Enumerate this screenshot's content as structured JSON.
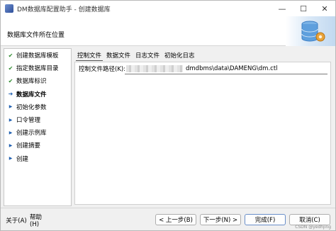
{
  "window": {
    "title": "DM数据库配置助手 - 创建数据库",
    "controls": {
      "minimize": "—",
      "maximize": "☐",
      "close": "✕"
    }
  },
  "header": {
    "title": "数据库文件所在位置",
    "art_icon": "database-gear-icon"
  },
  "steps": [
    {
      "label": "创建数据库模板",
      "state": "done"
    },
    {
      "label": "指定数据库目录",
      "state": "done"
    },
    {
      "label": "数据库标识",
      "state": "done"
    },
    {
      "label": "数据库文件",
      "state": "current"
    },
    {
      "label": "初始化参数",
      "state": "pending"
    },
    {
      "label": "口令管理",
      "state": "pending"
    },
    {
      "label": "创建示例库",
      "state": "pending"
    },
    {
      "label": "创建摘要",
      "state": "pending"
    },
    {
      "label": "创建",
      "state": "pending"
    }
  ],
  "tabs": [
    {
      "label": "控制文件",
      "active": true
    },
    {
      "label": "数据文件",
      "active": false
    },
    {
      "label": "日志文件",
      "active": false
    },
    {
      "label": "初始化日志",
      "active": false
    }
  ],
  "control_file": {
    "label": "控制文件路径(K):",
    "value": "dmdbms\\data\\DAMENG\\dm.ctl"
  },
  "buttons": {
    "about": "关于(A)",
    "help": "帮助(H)",
    "back": "< 上一步(B)",
    "next": "下一步(N) >",
    "finish": "完成(F)",
    "cancel": "取消(C)"
  },
  "watermark": "CSDN @yedhjing"
}
